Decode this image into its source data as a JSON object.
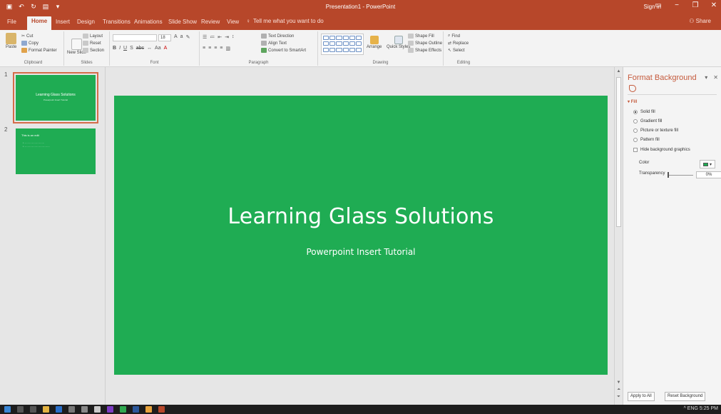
{
  "window": {
    "title": "Presentation1 - PowerPoint",
    "signin": "Sign in",
    "controls": [
      "−",
      "❐",
      "✕"
    ]
  },
  "qat_icons": [
    "save-icon",
    "undo-icon",
    "redo-icon",
    "start-from-beginning-icon",
    "customize-icon"
  ],
  "tabs": [
    {
      "label": "File"
    },
    {
      "label": "Home"
    },
    {
      "label": "Insert"
    },
    {
      "label": "Design"
    },
    {
      "label": "Transitions"
    },
    {
      "label": "Animations"
    },
    {
      "label": "Slide Show"
    },
    {
      "label": "Review"
    },
    {
      "label": "View"
    }
  ],
  "tellme": "Tell me what you want to do",
  "share": "Share",
  "ribbon": {
    "clipboard": {
      "paste": "Paste",
      "cut": "Cut",
      "copy": "Copy",
      "format_painter": "Format Painter",
      "label": "Clipboard"
    },
    "slides": {
      "new_slide": "New Slide",
      "layout": "Layout",
      "reset": "Reset",
      "section": "Section",
      "label": "Slides"
    },
    "font": {
      "size": "18",
      "label": "Font"
    },
    "paragraph": {
      "text_direction": "Text Direction",
      "align_text": "Align Text",
      "smartart": "Convert to SmartArt",
      "label": "Paragraph"
    },
    "drawing": {
      "arrange": "Arrange",
      "quick_styles": "Quick Styles",
      "shape_fill": "Shape Fill",
      "shape_outline": "Shape Outline",
      "shape_effects": "Shape Effects",
      "label": "Drawing"
    },
    "editing": {
      "find": "Find",
      "replace": "Replace",
      "select": "Select",
      "label": "Editing"
    }
  },
  "thumbnails": {
    "slide1": {
      "number": "1",
      "title": "Learning Glass Solutions",
      "subtitle": "Powerpoint Insert Tutorial"
    },
    "slide2": {
      "number": "2",
      "title": "This is an edit",
      "line1": "• ..................................",
      "line2": "• ..........................................."
    }
  },
  "slide": {
    "title": "Learning Glass Solutions",
    "subtitle": "Powerpoint Insert Tutorial"
  },
  "pane": {
    "title": "Format Background",
    "section": "Fill",
    "options": [
      {
        "label": "Solid fill",
        "selected": true
      },
      {
        "label": "Gradient fill",
        "selected": false
      },
      {
        "label": "Picture or texture fill",
        "selected": false
      },
      {
        "label": "Pattern fill",
        "selected": false
      }
    ],
    "hide_graphics": "Hide background graphics",
    "color_label": "Color",
    "transparency_label": "Transparency",
    "transparency_value": "0%",
    "apply_all": "Apply to All",
    "reset": "Reset Background"
  },
  "taskbar": {
    "tray": "^ ENG  5:25 PM"
  },
  "colors": {
    "accent": "#b7472a",
    "slide_bg": "#1fac53"
  }
}
